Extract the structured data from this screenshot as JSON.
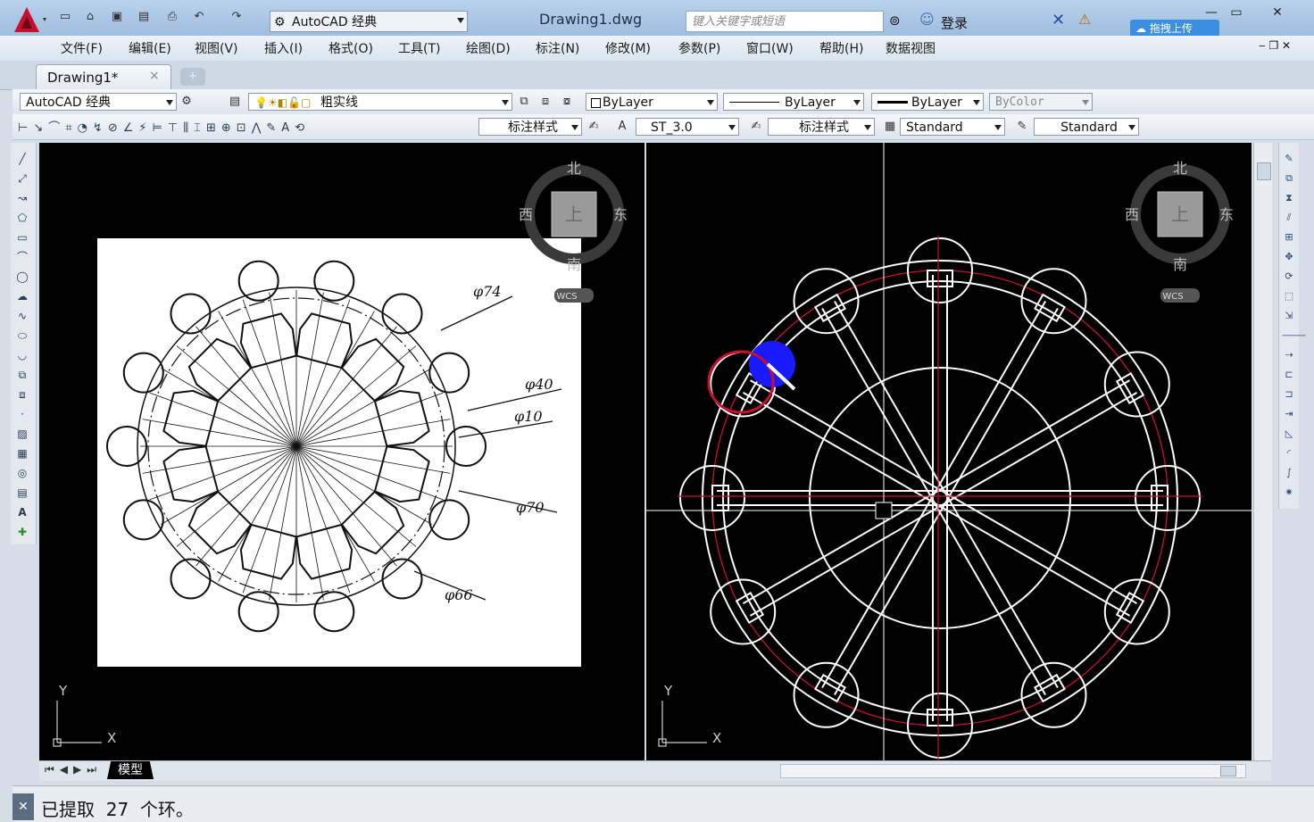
{
  "title_bar": {
    "workspace": "AutoCAD 经典",
    "document": "Drawing1.dwg",
    "search_placeholder": "键入关键字或短语",
    "login": "登录",
    "upload": "拖拽上传"
  },
  "menu": [
    "文件(F)",
    "编辑(E)",
    "视图(V)",
    "插入(I)",
    "格式(O)",
    "工具(T)",
    "绘图(D)",
    "标注(N)",
    "修改(M)",
    "参数(P)",
    "窗口(W)",
    "帮助(H)",
    "数据视图"
  ],
  "doc_tab": {
    "label": "Drawing1*",
    "close": "×"
  },
  "toolbar1": {
    "workspace": "AutoCAD 经典",
    "layer": "粗实线",
    "color": "ByLayer",
    "linetype": "ByLayer",
    "lineweight": "ByLayer",
    "plotstyle": "ByColor"
  },
  "toolbar2": {
    "dimstyle1": "标注样式",
    "textstyle": "ST_3.0",
    "dimstyle2": "标注样式",
    "tablestyle": "Standard",
    "mleaderstyle": "Standard"
  },
  "viewcube": {
    "north": "北",
    "south": "南",
    "east": "东",
    "west": "西",
    "top": "上",
    "wcs": "WCS"
  },
  "reference_image": {
    "labels": [
      "φ74",
      "φ40",
      "φ10",
      "φ70",
      "φ66"
    ]
  },
  "ucs": {
    "x": "X",
    "y": "Y"
  },
  "layout_tab": {
    "model": "模型"
  },
  "command_line": {
    "text": "已提取  27  个环。"
  },
  "colors": {
    "accent_red": "#c8102e",
    "cursor_blue": "#1a1aff",
    "viewport_bg": "#000000"
  }
}
